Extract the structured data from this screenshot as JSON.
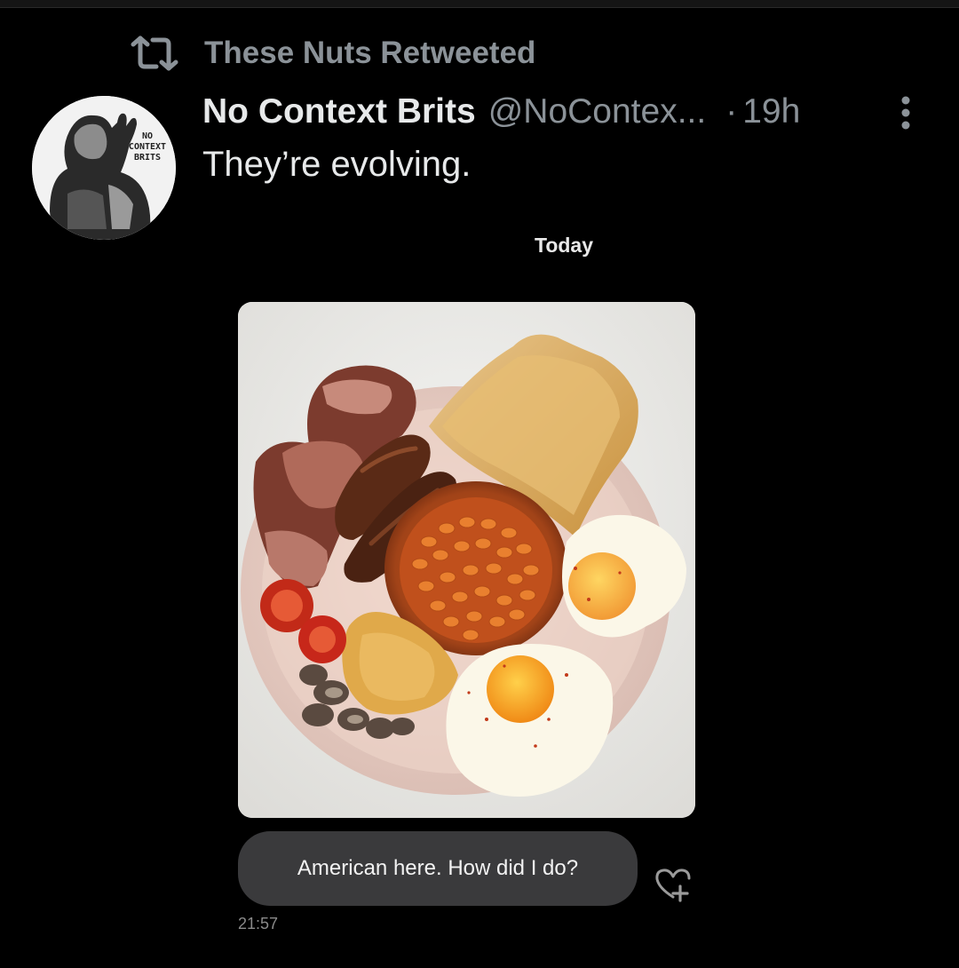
{
  "retweet": {
    "icon": "retweet-icon",
    "label": "These Nuts Retweeted"
  },
  "tweet": {
    "avatar": {
      "icon": "avatar",
      "logo_text": [
        "NO",
        "CONTEXT",
        "BRITS"
      ]
    },
    "display_name": "No Context Brits",
    "handle": "@NoContex...",
    "dot": "·",
    "time": "19h",
    "more_icon": "more-vertical-icon",
    "text": "They’re evolving."
  },
  "chat": {
    "day_label": "Today",
    "photo": "full-english-breakfast-photo",
    "message": "American here. How did I do?",
    "react_icon": "heart-plus-icon",
    "timestamp": "21:57"
  },
  "colors": {
    "background": "#000000",
    "primary_text": "#e7e9ea",
    "secondary_text": "#8b9298",
    "bubble": "#3a3a3c"
  }
}
